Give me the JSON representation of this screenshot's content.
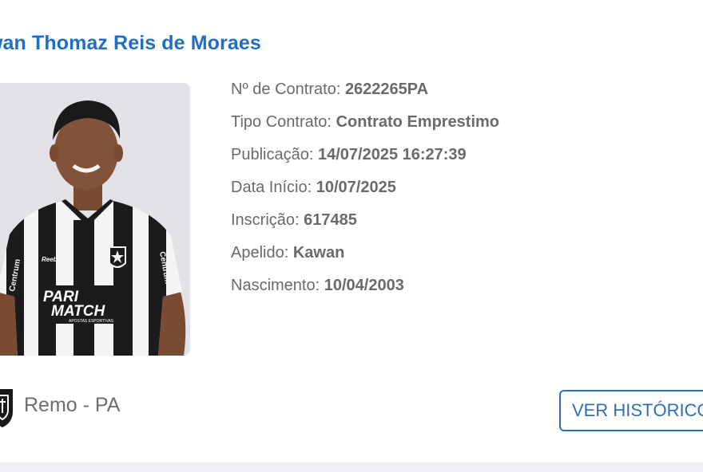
{
  "player": {
    "name": "wan Thomaz Reis de Moraes"
  },
  "details": [
    {
      "label": "Nº de Contrato:",
      "value": "2622265PA"
    },
    {
      "label": "Tipo Contrato:",
      "value": "Contrato Emprestimo"
    },
    {
      "label": "Publicação:",
      "value": "14/07/2025 16:27:39"
    },
    {
      "label": "Data Início:",
      "value": "10/07/2025"
    },
    {
      "label": "Inscrição:",
      "value": "617485"
    },
    {
      "label": "Apelido:",
      "value": "Kawan"
    },
    {
      "label": "Nascimento:",
      "value": "10/04/2003"
    }
  ],
  "photo": {
    "sponsor_top": "PARI",
    "sponsor_bottom": "MATCH",
    "sponsor_tagline": "APOSTAS ESPORTIVAS",
    "sleeve_text": "Centrum",
    "kit_brand": "Reebok"
  },
  "club": {
    "name": "Remo - PA",
    "crest_icon": "club-crest-icon"
  },
  "actions": {
    "history_label": "VER HISTÓRICO"
  },
  "colors": {
    "name_blue": "#1f6fc4",
    "button_blue": "#2f6fb8",
    "text_gray": "#6a6a6a"
  }
}
